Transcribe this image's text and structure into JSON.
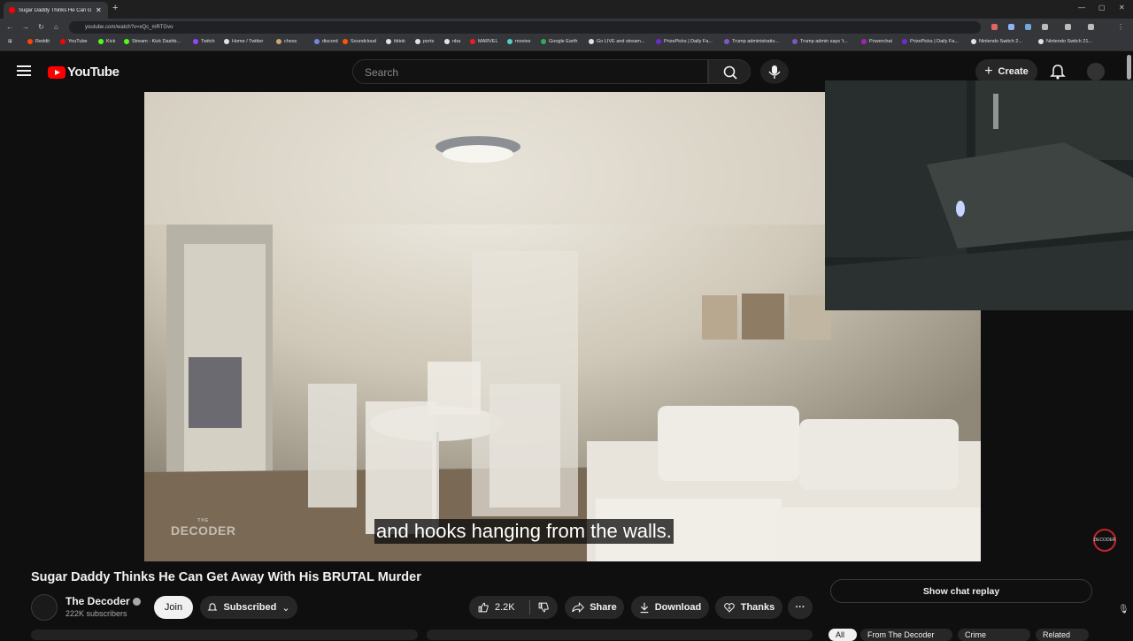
{
  "browser": {
    "tab_title": "Sugar Daddy Thinks He Can Get Away With His BRUTAL Murder",
    "new_tab": "+",
    "url": "youtube.com/watch?v=xQc_mRTGvo",
    "bookmarks": [
      "Reddit",
      "YouTube",
      "Kick",
      "Stream - Kick Dashb...",
      "Twitch",
      "Home / Twitter",
      "chess",
      "discord",
      "Soundcloud",
      "tiktok",
      "ports",
      "nba",
      "MARVEL",
      "movies",
      "Google Earth",
      "Go LIVE and stream...",
      "PrizePicks | Daily Fa...",
      "Trump administratio...",
      "Trump admin says 't...",
      "Powerchat",
      "PrizePicks | Daily Fa...",
      "Nintendo Switch 2...",
      "Nintendo Switch 21..."
    ]
  },
  "youtube": {
    "logo_text": "YouTube",
    "search_placeholder": "Search",
    "create_label": "Create"
  },
  "video": {
    "caption": "and hooks hanging from the walls.",
    "watermark_small": "THE",
    "watermark": "DECODER",
    "title": "Sugar Daddy Thinks He Can Get Away With His BRUTAL Murder",
    "channel_name": "The Decoder",
    "subscribers": "222K subscribers",
    "join_label": "Join",
    "subscribed_label": "Subscribed",
    "likes": "2.2K",
    "share_label": "Share",
    "download_label": "Download",
    "thanks_label": "Thanks",
    "more_label": "···",
    "chat_replay": "Show chat replay",
    "chips": [
      "All",
      "From The Decoder",
      "Crime",
      "Related"
    ],
    "corner_logo_text": "DECODER"
  }
}
